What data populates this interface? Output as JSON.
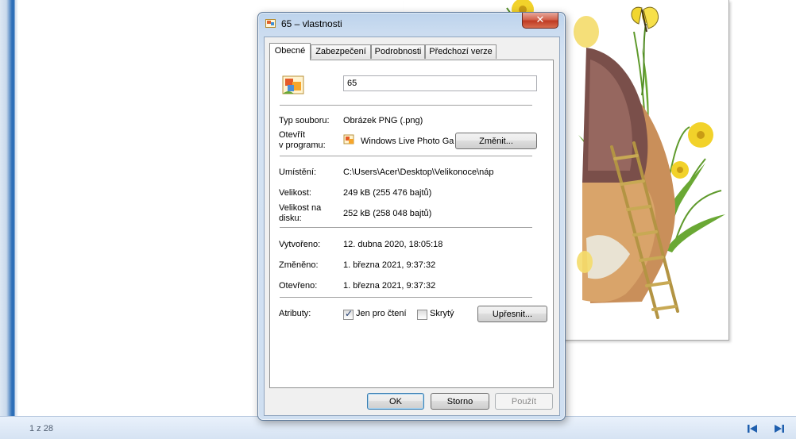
{
  "viewer": {
    "page_counter": "1 z 28",
    "nav_prev_icon": "skip-back-icon",
    "nav_next_icon": "skip-forward-icon",
    "accent_color": "#1f5fae"
  },
  "dialog": {
    "title": "65 – vlastnosti",
    "close_label": "✕",
    "tabs": [
      {
        "label": "Obecné",
        "active": true
      },
      {
        "label": "Zabezpečení",
        "active": false
      },
      {
        "label": "Podrobnosti",
        "active": false
      },
      {
        "label": "Předchozí verze",
        "active": false
      }
    ],
    "general": {
      "file_name": "65",
      "file_type_label": "Typ souboru:",
      "file_type_value": "Obrázek PNG (.png)",
      "open_with_label_1": "Otevřít",
      "open_with_label_2": "v programu:",
      "open_with_value": "Windows Live Photo Ga",
      "change_button": "Změnit...",
      "location_label": "Umístění:",
      "location_value": "C:\\Users\\Acer\\Desktop\\Velikonoce\\náp",
      "size_label": "Velikost:",
      "size_value": "249 kB (255 476 bajtů)",
      "disk_size_label_1": "Velikost na",
      "disk_size_label_2": "disku:",
      "disk_size_value": "252 kB (258 048 bajtů)",
      "created_label": "Vytvořeno:",
      "created_value": "12. dubna 2020, 18:05:18",
      "modified_label": "Změněno:",
      "modified_value": "1. března 2021, 9:37:32",
      "accessed_label": "Otevřeno:",
      "accessed_value": "1. března 2021, 9:37:32",
      "attributes_label": "Atributy:",
      "readonly_label": "Jen pro čtení",
      "readonly_checked": true,
      "hidden_label": "Skrytý",
      "hidden_checked": false,
      "advanced_button": "Upřesnit..."
    },
    "buttons": {
      "ok": "OK",
      "cancel": "Storno",
      "apply": "Použít"
    }
  }
}
